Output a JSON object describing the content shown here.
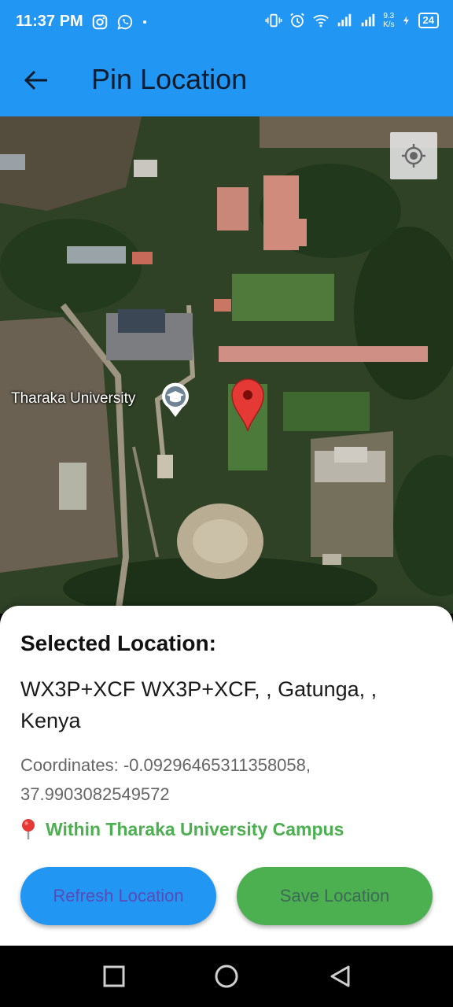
{
  "status_bar": {
    "time": "11:37 PM",
    "net_speed_top": "9.3",
    "net_speed_bottom": "K/s",
    "battery": "24",
    "icons": [
      "instagram-icon",
      "whatsapp-icon",
      "dot-icon",
      "vibrate-icon",
      "alarm-icon",
      "wifi-icon",
      "signal-icon",
      "signal-icon",
      "charging-icon",
      "battery-icon"
    ]
  },
  "app_bar": {
    "title": "Pin Location",
    "back_icon": "arrow-left-icon"
  },
  "map": {
    "poi_label": "Tharaka University",
    "poi_icon": "graduation-cap-icon",
    "locate_icon": "my-location-icon",
    "pin_icon": "map-pin-icon"
  },
  "sheet": {
    "title": "Selected Location:",
    "address": "WX3P+XCF WX3P+XCF, , Gatunga, , Kenya",
    "coordinates": "Coordinates: -0.09296465311358058, 37.9903082549572",
    "campus_status": "Within Tharaka University Campus",
    "refresh_label": "Refresh Location",
    "save_label": "Save Location"
  },
  "colors": {
    "primary": "#2196F3",
    "success": "#4CAF50",
    "pin": "#E53935"
  },
  "nav_bar": {
    "icons": [
      "recents-square-icon",
      "home-circle-icon",
      "back-triangle-icon"
    ]
  }
}
